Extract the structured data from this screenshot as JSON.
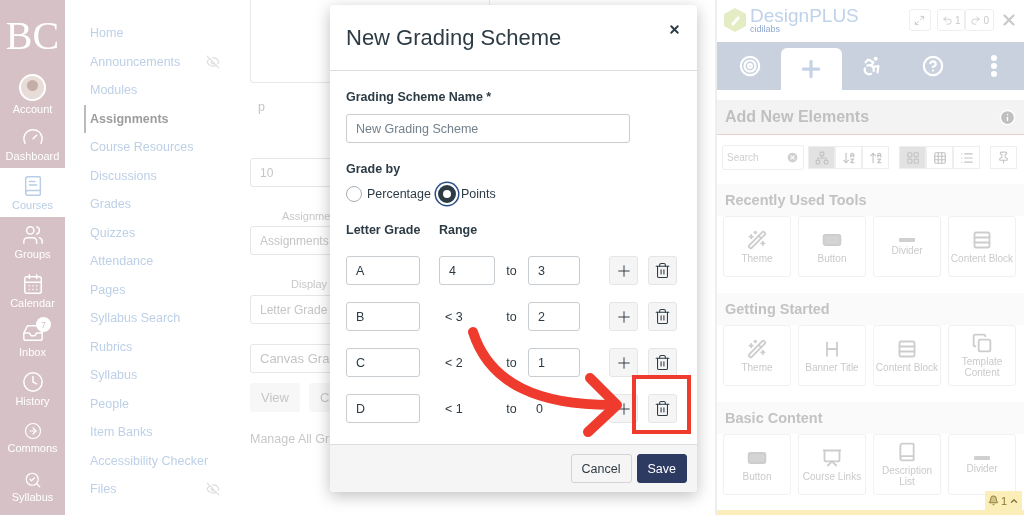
{
  "global_nav": {
    "logo": "BC",
    "items": [
      {
        "kind": "account",
        "label": "Account",
        "selected": false
      },
      {
        "kind": "dashboard",
        "label": "Dashboard",
        "selected": false
      },
      {
        "kind": "courses",
        "label": "Courses",
        "selected": true
      },
      {
        "kind": "groups",
        "label": "Groups",
        "selected": false
      },
      {
        "kind": "calendar",
        "label": "Calendar",
        "selected": false
      },
      {
        "kind": "inbox",
        "label": "Inbox",
        "selected": false,
        "badge": "7"
      },
      {
        "kind": "history",
        "label": "History",
        "selected": false
      },
      {
        "kind": "commons",
        "label": "Commons",
        "selected": false
      },
      {
        "kind": "syllabus-search",
        "label": "Syllabus",
        "selected": false
      }
    ]
  },
  "course_nav": {
    "items": [
      {
        "label": "Home",
        "selected": false,
        "hidden": false
      },
      {
        "label": "Announcements",
        "selected": false,
        "hidden": true
      },
      {
        "label": "Modules",
        "selected": false,
        "hidden": false
      },
      {
        "label": "Assignments",
        "selected": true,
        "hidden": false
      },
      {
        "label": "Course Resources",
        "selected": false,
        "hidden": false
      },
      {
        "label": "Discussions",
        "selected": false,
        "hidden": false
      },
      {
        "label": "Grades",
        "selected": false,
        "hidden": false
      },
      {
        "label": "Quizzes",
        "selected": false,
        "hidden": false
      },
      {
        "label": "Attendance",
        "selected": false,
        "hidden": false
      },
      {
        "label": "Pages",
        "selected": false,
        "hidden": false
      },
      {
        "label": "Syllabus Search",
        "selected": false,
        "hidden": false
      },
      {
        "label": "Rubrics",
        "selected": false,
        "hidden": false
      },
      {
        "label": "Syllabus",
        "selected": false,
        "hidden": false
      },
      {
        "label": "People",
        "selected": false,
        "hidden": false
      },
      {
        "label": "Item Banks",
        "selected": false,
        "hidden": false
      },
      {
        "label": "Accessibility Checker",
        "selected": false,
        "hidden": false
      },
      {
        "label": "Files",
        "selected": false,
        "hidden": true
      }
    ]
  },
  "page_form": {
    "paragraph_mark": "p",
    "points_value": "10",
    "group_label": "Assignme",
    "group_value": "Assignments",
    "display_label": "Display",
    "display_value": "Letter Grade",
    "scheme_value": "Canvas Gra",
    "buttons": [
      "View",
      "C"
    ],
    "manage_link": "Manage All Gr"
  },
  "dialog": {
    "title": "New Grading Scheme",
    "name_label": "Grading Scheme Name *",
    "name_placeholder": "New Grading Scheme",
    "grade_by_label": "Grade by",
    "grade_by_options": [
      {
        "label": "Percentage",
        "selected": false
      },
      {
        "label": "Points",
        "selected": true
      }
    ],
    "columns": [
      "Letter Grade",
      "Range"
    ],
    "rows": [
      {
        "letter": "A",
        "from": {
          "kind": "input",
          "value": "4"
        },
        "to_label": "to",
        "to": {
          "kind": "input",
          "value": "3"
        }
      },
      {
        "letter": "B",
        "from": {
          "kind": "text",
          "value": "< 3"
        },
        "to_label": "to",
        "to": {
          "kind": "input",
          "value": "2"
        }
      },
      {
        "letter": "C",
        "from": {
          "kind": "text",
          "value": "< 2"
        },
        "to_label": "to",
        "to": {
          "kind": "input",
          "value": "1"
        }
      },
      {
        "letter": "D",
        "from": {
          "kind": "text",
          "value": "< 1"
        },
        "to_label": "to",
        "to": {
          "kind": "text",
          "value": "0"
        }
      }
    ],
    "buttons": [
      {
        "label": "Cancel",
        "kind": "secondary"
      },
      {
        "label": "Save",
        "kind": "primary"
      }
    ]
  },
  "designplus": {
    "brand": "DesignPLUS",
    "brand_sub": "cidilabs",
    "undo_count": "1",
    "redo_count": "0",
    "tabs": [
      {
        "kind": "target",
        "selected": false
      },
      {
        "kind": "add",
        "selected": true
      },
      {
        "kind": "accessibility",
        "selected": false
      },
      {
        "kind": "help",
        "selected": false
      },
      {
        "kind": "more",
        "selected": false
      }
    ],
    "section_title": "Add New Elements",
    "search_placeholder": "Search",
    "sort_buttons": [
      {
        "kind": "tree",
        "selected": true
      },
      {
        "kind": "sort-az",
        "selected": false
      },
      {
        "kind": "sort-za",
        "selected": false
      }
    ],
    "view_buttons": [
      {
        "kind": "large",
        "selected": true
      },
      {
        "kind": "small",
        "selected": false
      },
      {
        "kind": "list",
        "selected": false
      }
    ],
    "groups": [
      {
        "title": "Recently Used Tools",
        "tools": [
          {
            "kind": "theme",
            "label": "Theme"
          },
          {
            "kind": "button",
            "label": "Button"
          },
          {
            "kind": "divider",
            "label": "Divider"
          },
          {
            "kind": "content-block",
            "label": "Content Block"
          }
        ]
      },
      {
        "title": "Getting Started",
        "tools": [
          {
            "kind": "theme",
            "label": "Theme"
          },
          {
            "kind": "banner-title",
            "label": "Banner Title"
          },
          {
            "kind": "content-block",
            "label": "Content Block"
          },
          {
            "kind": "template",
            "label": "Template Content"
          }
        ]
      },
      {
        "title": "Basic Content",
        "tools": [
          {
            "kind": "button",
            "label": "Button"
          },
          {
            "kind": "course-links",
            "label": "Course Links"
          },
          {
            "kind": "description-list",
            "label": "Description List"
          },
          {
            "kind": "divider",
            "label": "Divider"
          }
        ]
      }
    ],
    "notification_count": "1"
  }
}
